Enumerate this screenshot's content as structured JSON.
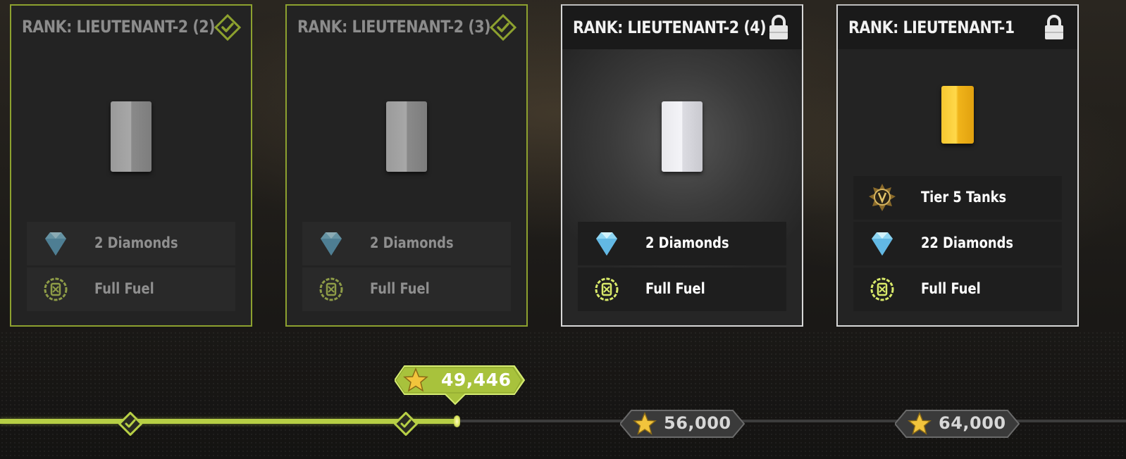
{
  "cards": [
    {
      "title": "RANK: LIEUTENANT-2 (2)",
      "status": "claimed",
      "status_icon": "check-diamond-icon",
      "rank_icon": "silver-bar-icon",
      "rewards": [
        {
          "icon": "diamond-icon",
          "label": "2 Diamonds"
        },
        {
          "icon": "fuel-icon",
          "label": "Full Fuel"
        }
      ]
    },
    {
      "title": "RANK: LIEUTENANT-2 (3)",
      "status": "claimed",
      "status_icon": "check-diamond-icon",
      "rank_icon": "silver-bar-icon",
      "rewards": [
        {
          "icon": "diamond-icon",
          "label": "2 Diamonds"
        },
        {
          "icon": "fuel-icon",
          "label": "Full Fuel"
        }
      ]
    },
    {
      "title": "RANK: LIEUTENANT-2 (4)",
      "status": "locked",
      "status_icon": "padlock-icon",
      "rank_icon": "silver-bar-icon",
      "rewards": [
        {
          "icon": "diamond-icon",
          "label": "2 Diamonds"
        },
        {
          "icon": "fuel-icon",
          "label": "Full Fuel"
        }
      ]
    },
    {
      "title": "RANK: LIEUTENANT-1",
      "status": "locked",
      "status_icon": "padlock-icon",
      "rank_icon": "gold-bar-icon",
      "rewards": [
        {
          "icon": "tier-v-badge-icon",
          "label": "Tier 5 Tanks"
        },
        {
          "icon": "diamond-icon",
          "label": "22 Diamonds"
        },
        {
          "icon": "fuel-icon",
          "label": "Full Fuel"
        }
      ]
    }
  ],
  "progress": {
    "current_points": "49,446",
    "milestones": [
      "56,000",
      "64,000"
    ],
    "star_icon": "gold-star-icon",
    "colors": {
      "accent": "#b7cf45",
      "track": "#3c3c3c"
    }
  }
}
